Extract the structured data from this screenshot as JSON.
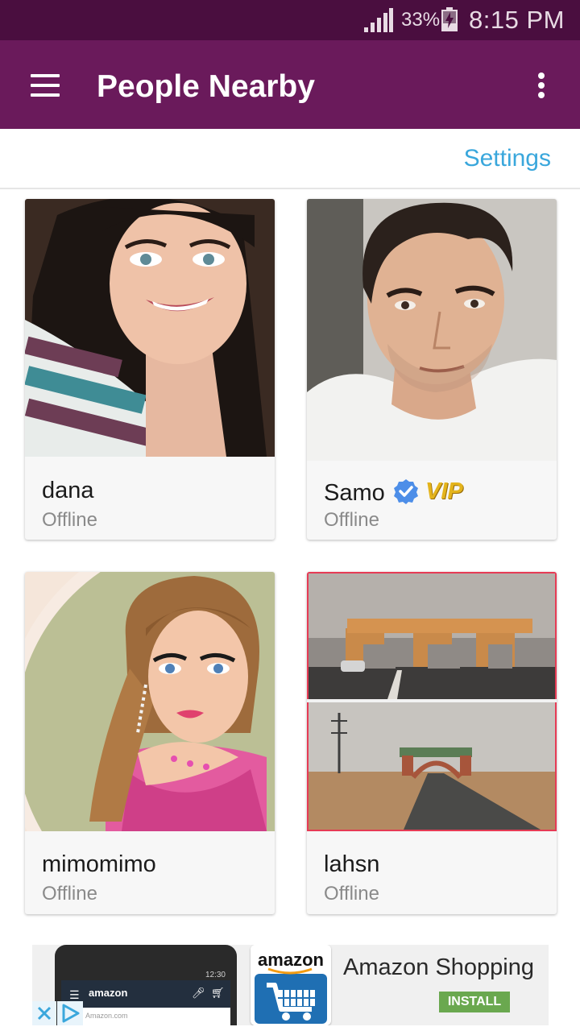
{
  "status_bar": {
    "battery_percent": "33%",
    "time": "8:15 PM",
    "signal_icon": "signal-strength-icon",
    "battery_icon": "battery-charging-icon"
  },
  "app_bar": {
    "title": "People Nearby",
    "menu_icon": "hamburger-menu-icon",
    "overflow_icon": "more-vert-icon"
  },
  "settings": {
    "label": "Settings"
  },
  "people": [
    {
      "name": "dana",
      "status": "Offline"
    },
    {
      "name": "Samo",
      "status": "Offline",
      "verified": true,
      "badge": "VIP"
    },
    {
      "name": "mimomimo",
      "status": "Offline"
    },
    {
      "name": "lahsn",
      "status": "Offline"
    }
  ],
  "ad": {
    "brand": "amazon",
    "title": "Amazon Shopping",
    "install_label": "INSTALL",
    "phone_time": "12:30",
    "phone_url": "Amazon.com",
    "close_icon": "close-icon",
    "ad_choices_icon": "ad-choices-icon"
  },
  "colors": {
    "status_bar": "#4a0e3f",
    "app_bar": "#6a1a5b",
    "link": "#3aa7dc",
    "secondary_text": "#8a8a8a",
    "install": "#6aa84f"
  }
}
